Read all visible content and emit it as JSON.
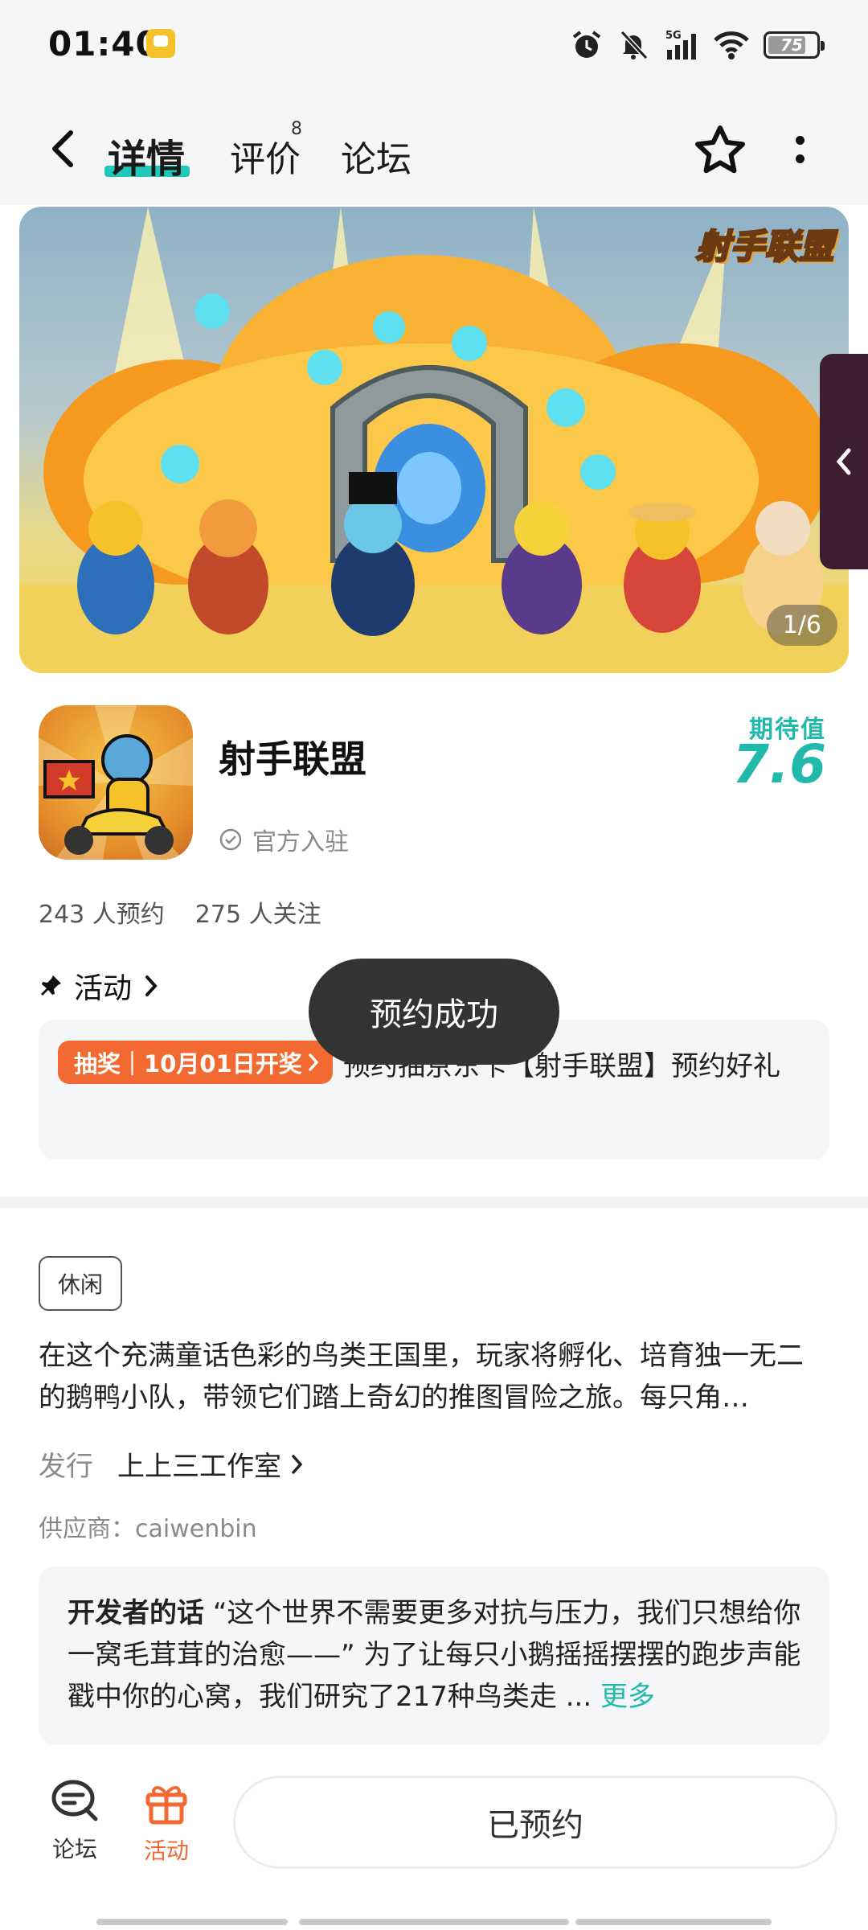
{
  "status": {
    "time": "01:40",
    "battery": "75",
    "network": "5G"
  },
  "header": {
    "tabs": [
      {
        "label": "详情",
        "active": true
      },
      {
        "label": "评价",
        "badge": "8"
      },
      {
        "label": "论坛"
      }
    ]
  },
  "banner": {
    "logo_text": "射手联盟",
    "counter": "1/6"
  },
  "app": {
    "name": "射手联盟",
    "verified_label": "官方入驻",
    "score_label": "期待值",
    "score_value": "7.6",
    "reservations": "243 人预约",
    "followers": "275 人关注"
  },
  "activity": {
    "title": "活动",
    "tag": "抽奖｜10月01日开奖",
    "text": "预约抽京东卡【射手联盟】预约好礼"
  },
  "toast": "预约成功",
  "details": {
    "tag": "休闲",
    "description": "在这个充满童话色彩的鸟类王国里，玩家将孵化、培育独一无二的鹅鸭小队，带领它们踏上奇幻的推图冒险之旅。每只角…",
    "publisher_label": "发行",
    "publisher": "上上三工作室",
    "supplier": "供应商：caiwenbin"
  },
  "developer": {
    "label": "开发者的话",
    "text": "“这个世界不需要更多对抗与压力，我们只想给你一窝毛茸茸的治愈——” 为了让每只小鹅摇摇摆摆的跑步声能戳中你的心窝，我们研究了217种鸟类走 ...",
    "more": "更多"
  },
  "bottom": {
    "forum_label": "论坛",
    "activity_label": "活动",
    "reserved_label": "已预约"
  },
  "colors": {
    "accent": "#20b9ab",
    "orange": "#f26a32",
    "toast": "#333333"
  }
}
